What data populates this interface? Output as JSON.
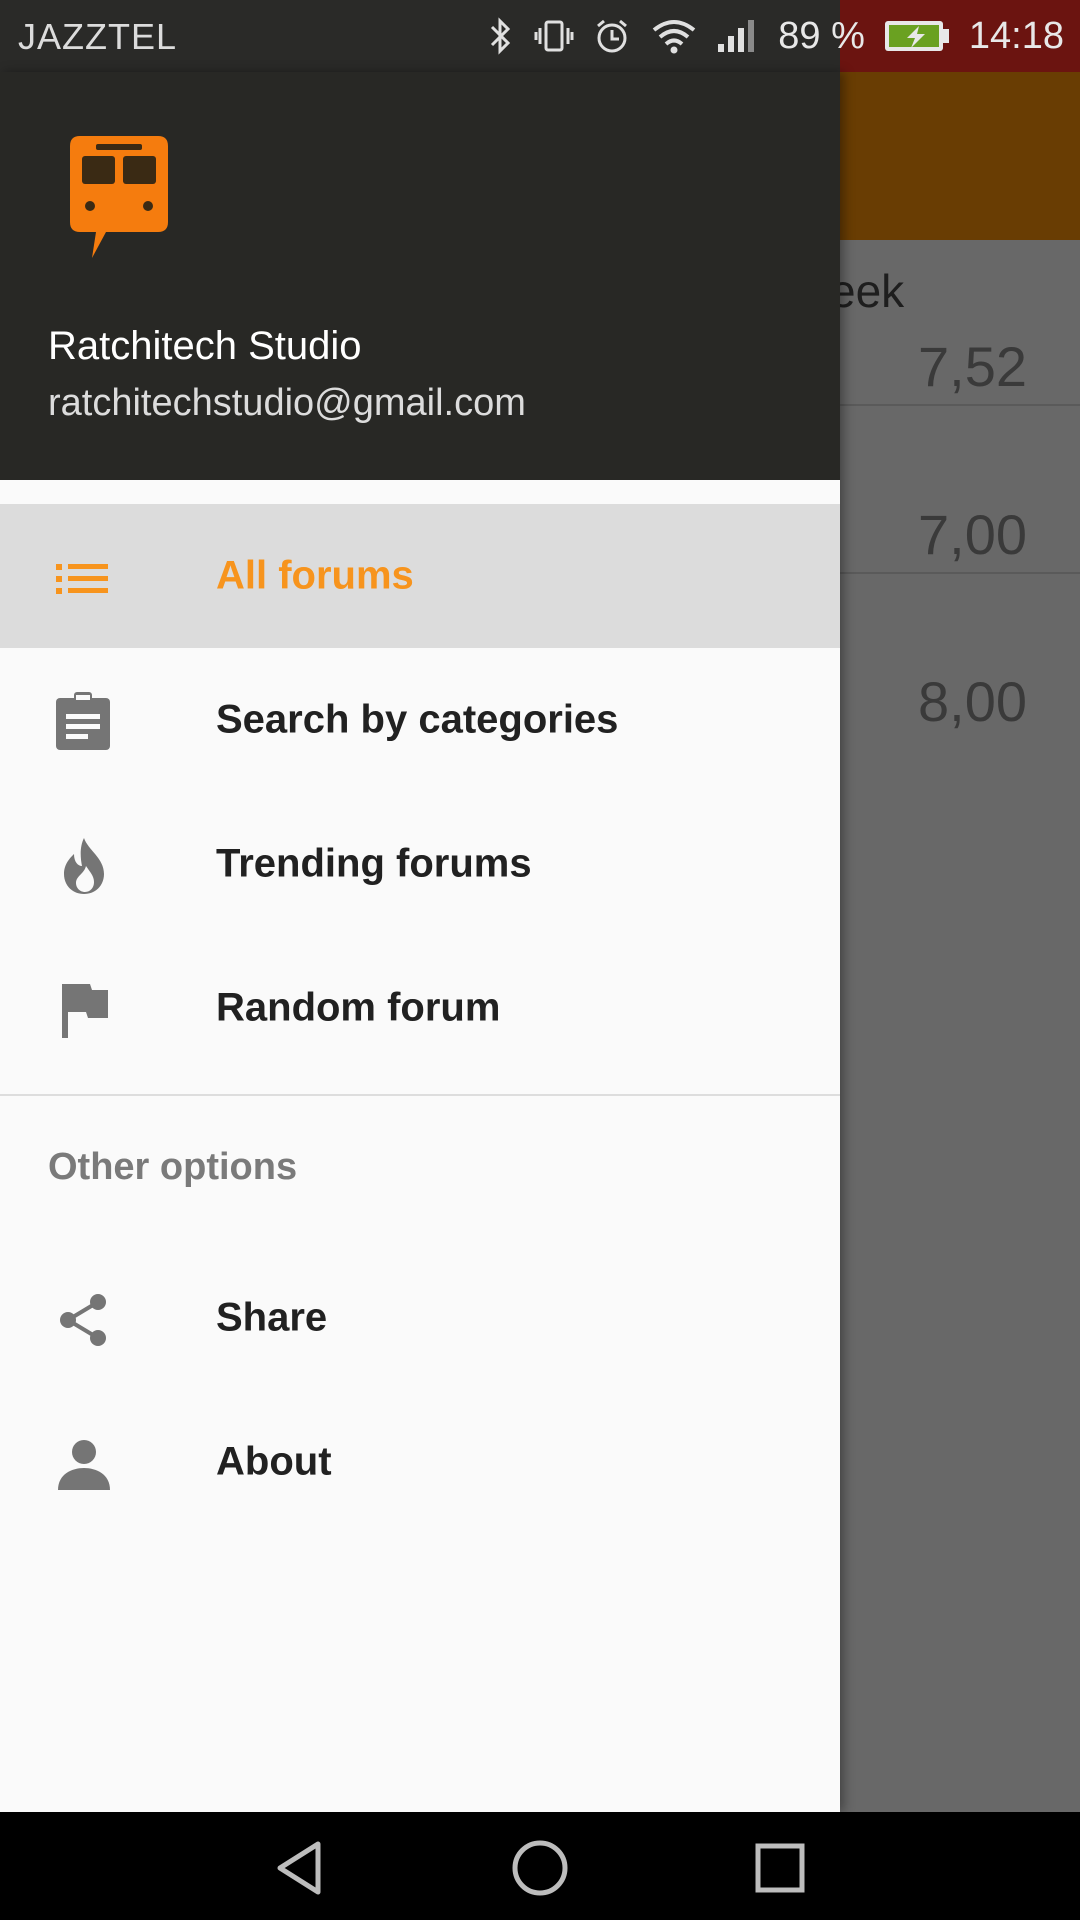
{
  "status_bar": {
    "carrier": "JAZZTEL",
    "battery_percent": "89 %",
    "time": "14:18",
    "icons": [
      "bluetooth-icon",
      "vibrate-icon",
      "alarm-icon",
      "wifi-icon",
      "signal-icon",
      "battery-charging-icon"
    ]
  },
  "background_app": {
    "week_label": "eek",
    "values": [
      "7,52",
      "7,00",
      "8,00"
    ],
    "toolbar_color": "#693d03"
  },
  "drawer": {
    "header": {
      "logo": "train-chat-logo",
      "user_name": "Ratchitech Studio",
      "user_email": "ratchitechstudio@gmail.com"
    },
    "items": [
      {
        "label": "All forums",
        "icon": "list-icon",
        "active": true
      },
      {
        "label": "Search by categories",
        "icon": "clipboard-icon",
        "active": false
      },
      {
        "label": "Trending forums",
        "icon": "flame-icon",
        "active": false
      },
      {
        "label": "Random forum",
        "icon": "flag-icon",
        "active": false
      }
    ],
    "other_section": {
      "title": "Other options",
      "items": [
        {
          "label": "Share",
          "icon": "share-icon"
        },
        {
          "label": "About",
          "icon": "person-icon"
        }
      ]
    }
  },
  "colors": {
    "accent": "#f7941d",
    "header_bg": "#282825",
    "active_bg": "#dcdcdc"
  },
  "nav_bar": {
    "buttons": [
      "back-icon",
      "home-icon",
      "recents-icon"
    ]
  }
}
